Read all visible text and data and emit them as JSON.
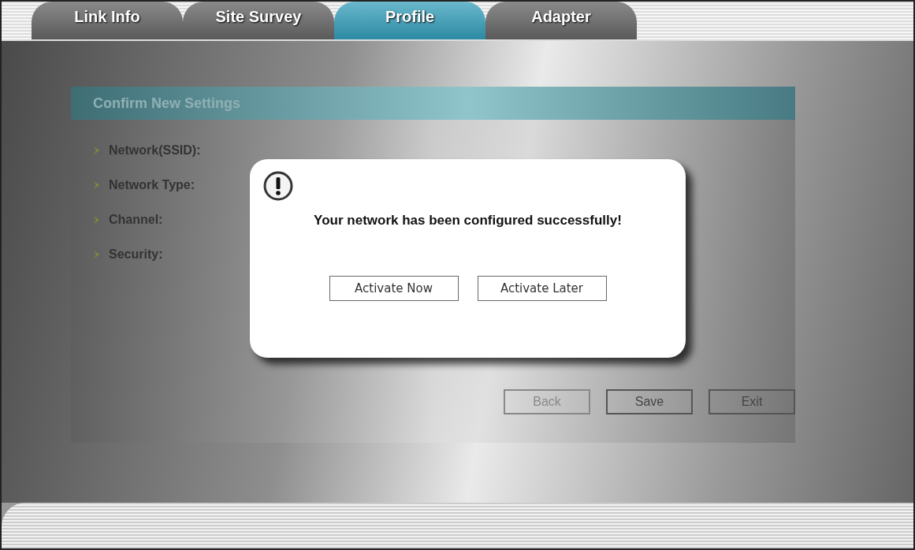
{
  "tabs": [
    {
      "label": "Link Info",
      "selected": false
    },
    {
      "label": "Site Survey",
      "selected": false
    },
    {
      "label": "Profile",
      "selected": true
    },
    {
      "label": "Adapter",
      "selected": false
    }
  ],
  "panel": {
    "title": "Confirm New Settings",
    "fields": [
      {
        "label": "Network(SSID):"
      },
      {
        "label": "Network Type:"
      },
      {
        "label": "Channel:"
      },
      {
        "label": "Security:"
      }
    ],
    "buttons": [
      {
        "label": "Back",
        "disabled": true
      },
      {
        "label": "Save",
        "disabled": false
      },
      {
        "label": "Exit",
        "disabled": false
      }
    ]
  },
  "dialog": {
    "message": "Your network has been configured successfully!",
    "buttons": [
      "Activate Now",
      "Activate Later"
    ]
  }
}
